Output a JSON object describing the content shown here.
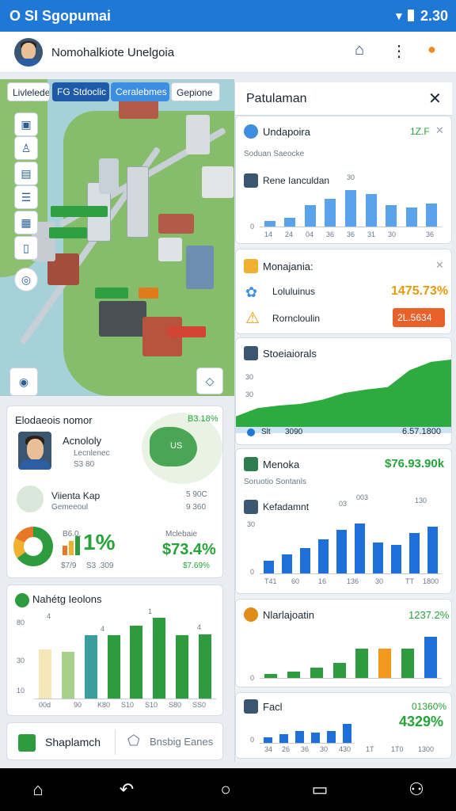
{
  "status": {
    "left": "O SI Sgopumai",
    "time": "2.30"
  },
  "appbar": {
    "title": "Nomohalkiote Unelgoia"
  },
  "tabs": [
    {
      "label": "Livlelede"
    },
    {
      "label": "FG Stdoclic"
    },
    {
      "label": "Ceralebmes"
    },
    {
      "label": "Gepione"
    }
  ],
  "map_labels": [
    "",
    "",
    "",
    "",
    ""
  ],
  "left_card1": {
    "title": "Elodaeois nomor",
    "badge": "B3.18%",
    "person1_name": "Acnololy",
    "person1_sub1": "Lecnlenec",
    "person1_sub2": "S3 80",
    "person2_name": "Viienta Kap",
    "person2_sub": "Gemeeoul",
    "person2_val1": "5 90C",
    "person2_val2": "9 360",
    "donut_top": "B6.0,",
    "metric_label": "Mclebaie",
    "metric_value": "$73.4%",
    "foot1": "$7/9",
    "foot2": "S3 .309",
    "foot3": "$7.69%",
    "mini_big": "1%",
    "map_text": "US"
  },
  "left_card2": {
    "title": "Nahétg Ieolons",
    "y_ticks": [
      "80",
      "30",
      "10"
    ],
    "x_ticks": [
      "00d",
      "90",
      "K80",
      "S10",
      "S10",
      "S80",
      "SS0"
    ],
    "marks": [
      "4",
      "1",
      "4",
      "4"
    ]
  },
  "left_buttons": {
    "primary": "Shaplamch",
    "secondary": "Bnsbig Eanes"
  },
  "right_panel": {
    "title": "Patulaman",
    "cards": [
      {
        "title": "Undapoira",
        "value": "1Z.F",
        "subtitle": "Soduan Saeocke",
        "row_label": "Rene Ianculdan",
        "top_mark": "30",
        "y_tick": "0",
        "x_ticks": [
          "14",
          "24",
          "04",
          "36",
          "36",
          "31",
          "30",
          "36"
        ]
      },
      {
        "title": "Monajania:",
        "row1": "Loluluinus",
        "row2": "Rorncloulin",
        "value": "1475.73%",
        "badge": "2L.5634"
      },
      {
        "title": "Stoeiaiorals",
        "y_ticks": [
          "30",
          "30",
          "0"
        ],
        "foot_left": "Slt",
        "foot_mid": "3090",
        "foot_right": "6.57.1800"
      },
      {
        "title": "Menoka",
        "value": "$76.93.90k",
        "subtitle": "Soruotio Sontanls",
        "row_label": "Kefadamnt",
        "marks": [
          "03",
          "003",
          "130"
        ],
        "y_ticks": [
          "30",
          "0"
        ],
        "x_ticks": [
          "T41",
          "60",
          "16",
          "136",
          "30",
          "TT",
          "1800"
        ]
      },
      {
        "title": "Nlarlajoatin",
        "value": "1237.2%",
        "y_tick": "0"
      },
      {
        "title": "Facl",
        "value1": "01360%",
        "value2": "4329%",
        "y_tick": "0",
        "x_ticks": [
          "34",
          "26",
          "36",
          "30",
          "430",
          "1T",
          "1T0",
          "1300"
        ]
      }
    ]
  },
  "colors": {
    "primary": "#1f77d6",
    "accent": "#26a339",
    "orange": "#f39a1e"
  },
  "chart_data": [
    {
      "type": "bar",
      "title": "Nahétg Ieolons",
      "categories": [
        "00d",
        "90",
        "K80",
        "S10",
        "S10",
        "S80",
        "SS0"
      ],
      "values": [
        58,
        55,
        75,
        75,
        86,
        95,
        75,
        76
      ],
      "ylim": [
        0,
        100
      ]
    },
    {
      "type": "bar",
      "title": "Undapoira",
      "values": [
        8,
        12,
        30,
        38,
        50,
        45,
        30,
        26,
        32
      ],
      "ylim": [
        0,
        60
      ]
    },
    {
      "type": "area",
      "title": "Stoeiaiorals",
      "values": [
        20,
        30,
        33,
        35,
        40,
        48,
        52,
        55,
        75,
        85,
        88
      ],
      "ylim": [
        0,
        100
      ]
    },
    {
      "type": "bar",
      "title": "Menoka",
      "values": [
        20,
        30,
        40,
        55,
        70,
        80,
        50,
        45,
        65,
        75
      ],
      "ylim": [
        0,
        100
      ]
    },
    {
      "type": "bar",
      "title": "Nlarlajoatin",
      "values": [
        5,
        8,
        12,
        18,
        35,
        35,
        35,
        50
      ],
      "ylim": [
        0,
        60
      ]
    },
    {
      "type": "bar",
      "title": "Facl",
      "values": [
        12,
        20,
        28,
        24,
        28,
        44
      ],
      "ylim": [
        0,
        60
      ]
    }
  ]
}
